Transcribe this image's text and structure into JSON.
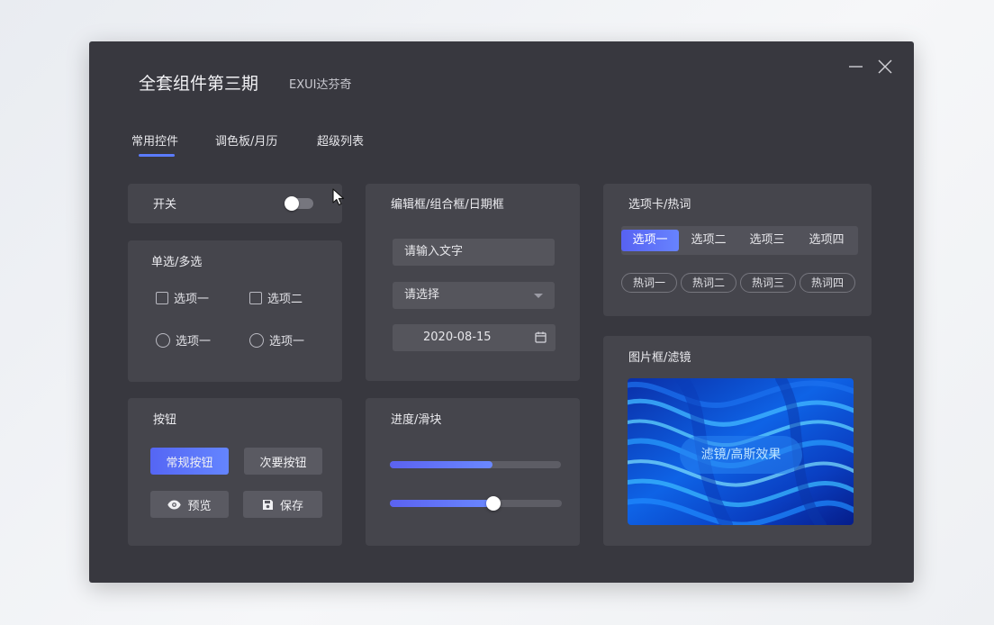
{
  "window": {
    "title": "全套组件第三期",
    "subtitle": "EXUI达芬奇",
    "minimize_icon": "minimize-icon",
    "close_icon": "close-icon"
  },
  "tabs": [
    {
      "label": "常用控件",
      "active": true
    },
    {
      "label": "调色板/月历",
      "active": false
    },
    {
      "label": "超级列表",
      "active": false
    }
  ],
  "switch_card": {
    "title": "开关",
    "switch_on": false
  },
  "choice_card": {
    "title": "单选/多选",
    "checkboxes": [
      "选项一",
      "选项二"
    ],
    "radios": [
      "选项一",
      "选项一"
    ]
  },
  "button_card": {
    "title": "按钮",
    "primary_label": "常规按钮",
    "secondary_label": "次要按钮",
    "preview_label": "预览",
    "save_label": "保存"
  },
  "edit_card": {
    "title": "编辑框/组合框/日期框",
    "input_placeholder": "请输入文字",
    "select_value": "请选择",
    "date_value": "2020-08-15"
  },
  "progress_card": {
    "title": "进度/滑块",
    "progress_percent": 60,
    "slider_percent": 60
  },
  "tabs_card": {
    "title": "选项卡/热词",
    "segments": [
      "选项一",
      "选项二",
      "选项三",
      "选项四"
    ],
    "active_segment": 0,
    "hot_words": [
      "热词一",
      "热词二",
      "热词三",
      "热词四"
    ]
  },
  "image_card": {
    "title": "图片框/滤镜",
    "filter_label": "滤镜/高斯效果"
  },
  "colors": {
    "window_bg": "#38383f",
    "card_bg": "#45454c",
    "accent": "#5b7cff"
  }
}
